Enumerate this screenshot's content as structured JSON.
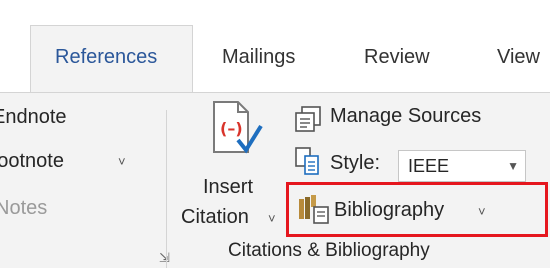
{
  "tabs": [
    "References",
    "Mailings",
    "Review",
    "View"
  ],
  "footnotes_group": {
    "items": [
      "Endnote",
      "Footnote",
      "Notes"
    ],
    "footnote_dropdown_glyph": "˅"
  },
  "citations_group": {
    "insert_citation_line1": "Insert",
    "insert_citation_line2": "Citation",
    "manage_sources": "Manage Sources",
    "style_label": "Style:",
    "style_value": "IEEE",
    "bibliography": "Bibliography",
    "group_label": "Citations & Bibliography",
    "dropdown_glyph": "˅"
  },
  "colors": {
    "active_tab_text": "#2b579a",
    "highlight_border": "#e5161e",
    "citation_icon_red": "#d9342b",
    "check_blue": "#1e6ebf"
  }
}
